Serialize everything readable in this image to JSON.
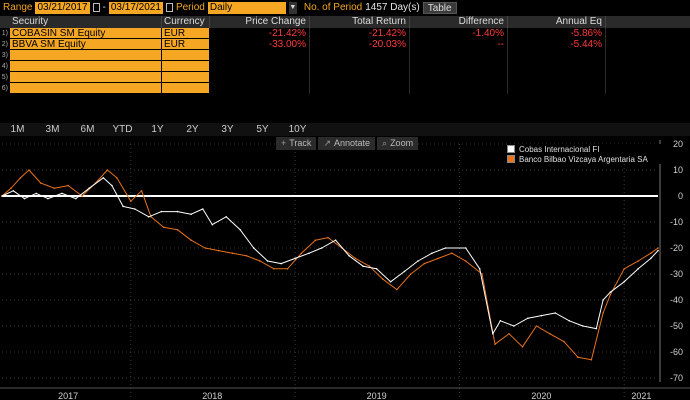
{
  "topbar": {
    "range_label": "Range",
    "start_date": "03/21/2017",
    "separator": "-",
    "end_date": "03/17/2021",
    "period_label": "Period",
    "period_value": "Daily",
    "num_periods_label": "No. of Period",
    "num_periods_value": "1457 Day(s)",
    "table_button": "Table"
  },
  "table": {
    "headers": [
      "Security",
      "Currency",
      "Price Change",
      "Total Return",
      "Difference",
      "Annual Eq"
    ],
    "rows": [
      {
        "num": "1)",
        "security": "COBASIN SM Equity",
        "currency": "EUR",
        "price_change": "-21.42%",
        "total_return": "-21.42%",
        "difference": "-1.40%",
        "annual_eq": "-5.86%"
      },
      {
        "num": "2)",
        "security": "BBVA SM Equity",
        "currency": "EUR",
        "price_change": "-33.00%",
        "total_return": "-20.03%",
        "difference": "--",
        "annual_eq": "-5.44%"
      },
      {
        "num": "3)",
        "security": "",
        "currency": "",
        "price_change": "",
        "total_return": "",
        "difference": "",
        "annual_eq": ""
      },
      {
        "num": "4)",
        "security": "",
        "currency": "",
        "price_change": "",
        "total_return": "",
        "difference": "",
        "annual_eq": ""
      },
      {
        "num": "5)",
        "security": "",
        "currency": "",
        "price_change": "",
        "total_return": "",
        "difference": "",
        "annual_eq": ""
      },
      {
        "num": "6)",
        "security": "",
        "currency": "",
        "price_change": "",
        "total_return": "",
        "difference": "",
        "annual_eq": ""
      }
    ]
  },
  "ranges": [
    "1M",
    "3M",
    "6M",
    "YTD",
    "1Y",
    "2Y",
    "3Y",
    "5Y",
    "10Y"
  ],
  "tools": [
    {
      "icon": "track-icon",
      "glyph": "+",
      "label": "Track"
    },
    {
      "icon": "annotate-icon",
      "glyph": "↗",
      "label": "Annotate"
    },
    {
      "icon": "zoom-icon",
      "glyph": "⌕",
      "label": "Zoom"
    }
  ],
  "colors": {
    "accent": "#f5a623",
    "negative": "#ff3a3a",
    "series_cobas": "#ffffff",
    "series_bbva": "#e8731c"
  },
  "chart_data": {
    "type": "line",
    "ylim": [
      -70,
      20
    ],
    "yticks": [
      20,
      10,
      0,
      -10,
      -20,
      -30,
      -40,
      -50,
      -60,
      -70
    ],
    "x_tick_labels": [
      "2017",
      "2018",
      "2019",
      "2020",
      "2021"
    ],
    "x_range": [
      "2017-03-21",
      "2021-03-17"
    ],
    "zero_line": true,
    "legend_position": "top-right",
    "series": [
      {
        "name": "Cobas Internacional FI",
        "color": "#ffffff",
        "points": [
          [
            "2017-03-21",
            0
          ],
          [
            "2017-04-15",
            2
          ],
          [
            "2017-05-10",
            -1
          ],
          [
            "2017-06-05",
            1
          ],
          [
            "2017-07-01",
            -1
          ],
          [
            "2017-08-01",
            1
          ],
          [
            "2017-09-01",
            -1
          ],
          [
            "2017-10-01",
            3
          ],
          [
            "2017-11-01",
            7
          ],
          [
            "2017-11-20",
            4
          ],
          [
            "2017-12-15",
            -4
          ],
          [
            "2018-01-10",
            -5
          ],
          [
            "2018-02-10",
            -8
          ],
          [
            "2018-03-10",
            -6
          ],
          [
            "2018-04-15",
            -6
          ],
          [
            "2018-05-15",
            -7
          ],
          [
            "2018-06-10",
            -5
          ],
          [
            "2018-07-01",
            -11
          ],
          [
            "2018-08-01",
            -8
          ],
          [
            "2018-09-01",
            -13
          ],
          [
            "2018-10-01",
            -20
          ],
          [
            "2018-11-01",
            -25
          ],
          [
            "2018-12-01",
            -26
          ],
          [
            "2019-01-01",
            -24
          ],
          [
            "2019-02-01",
            -22
          ],
          [
            "2019-03-01",
            -20
          ],
          [
            "2019-04-01",
            -17
          ],
          [
            "2019-05-01",
            -23
          ],
          [
            "2019-06-01",
            -27
          ],
          [
            "2019-07-01",
            -28
          ],
          [
            "2019-08-01",
            -33
          ],
          [
            "2019-09-01",
            -29
          ],
          [
            "2019-10-01",
            -25
          ],
          [
            "2019-11-01",
            -22
          ],
          [
            "2019-12-01",
            -20
          ],
          [
            "2020-01-15",
            -20
          ],
          [
            "2020-02-15",
            -28
          ],
          [
            "2020-03-15",
            -53
          ],
          [
            "2020-04-01",
            -48
          ],
          [
            "2020-05-01",
            -50
          ],
          [
            "2020-06-01",
            -47
          ],
          [
            "2020-07-01",
            -46
          ],
          [
            "2020-08-01",
            -45
          ],
          [
            "2020-09-01",
            -48
          ],
          [
            "2020-10-01",
            -50
          ],
          [
            "2020-10-31",
            -51
          ],
          [
            "2020-11-15",
            -40
          ],
          [
            "2020-12-01",
            -37
          ],
          [
            "2021-01-01",
            -33
          ],
          [
            "2021-02-01",
            -28
          ],
          [
            "2021-03-01",
            -24
          ],
          [
            "2021-03-17",
            -21
          ]
        ]
      },
      {
        "name": "Banco Bilbao Vizcaya Argentaria SA",
        "color": "#e8731c",
        "points": [
          [
            "2017-03-21",
            0
          ],
          [
            "2017-04-10",
            3
          ],
          [
            "2017-05-01",
            7
          ],
          [
            "2017-05-20",
            10
          ],
          [
            "2017-06-15",
            5
          ],
          [
            "2017-07-15",
            3
          ],
          [
            "2017-08-15",
            4
          ],
          [
            "2017-09-15",
            0
          ],
          [
            "2017-10-15",
            5
          ],
          [
            "2017-11-10",
            10
          ],
          [
            "2017-12-01",
            7
          ],
          [
            "2018-01-01",
            -2
          ],
          [
            "2018-01-25",
            2
          ],
          [
            "2018-02-15",
            -8
          ],
          [
            "2018-03-15",
            -12
          ],
          [
            "2018-04-15",
            -13
          ],
          [
            "2018-05-15",
            -17
          ],
          [
            "2018-06-15",
            -20
          ],
          [
            "2018-07-15",
            -21
          ],
          [
            "2018-08-15",
            -22
          ],
          [
            "2018-09-15",
            -23
          ],
          [
            "2018-10-15",
            -25
          ],
          [
            "2018-11-15",
            -28
          ],
          [
            "2018-12-15",
            -28
          ],
          [
            "2019-01-15",
            -22
          ],
          [
            "2019-02-15",
            -17
          ],
          [
            "2019-03-15",
            -16
          ],
          [
            "2019-04-15",
            -20
          ],
          [
            "2019-05-15",
            -24
          ],
          [
            "2019-06-15",
            -27
          ],
          [
            "2019-07-15",
            -32
          ],
          [
            "2019-08-15",
            -36
          ],
          [
            "2019-09-15",
            -30
          ],
          [
            "2019-10-15",
            -26
          ],
          [
            "2019-11-15",
            -24
          ],
          [
            "2019-12-15",
            -22
          ],
          [
            "2020-01-15",
            -25
          ],
          [
            "2020-02-20",
            -30
          ],
          [
            "2020-03-20",
            -57
          ],
          [
            "2020-04-20",
            -53
          ],
          [
            "2020-05-20",
            -58
          ],
          [
            "2020-06-20",
            -50
          ],
          [
            "2020-07-20",
            -53
          ],
          [
            "2020-08-20",
            -56
          ],
          [
            "2020-09-20",
            -62
          ],
          [
            "2020-10-20",
            -63
          ],
          [
            "2020-11-15",
            -45
          ],
          [
            "2020-12-01",
            -38
          ],
          [
            "2021-01-01",
            -28
          ],
          [
            "2021-02-01",
            -25
          ],
          [
            "2021-03-01",
            -22
          ],
          [
            "2021-03-17",
            -20
          ]
        ]
      }
    ]
  }
}
